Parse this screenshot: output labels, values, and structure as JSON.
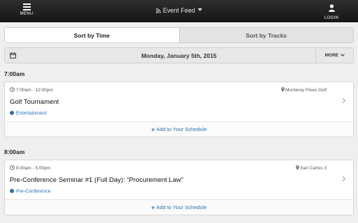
{
  "header": {
    "menu_label": "MENU",
    "feed_title": "Event Feed",
    "login_label": "LOGIN"
  },
  "sort_tabs": [
    {
      "label": "Sort by Time",
      "active": true
    },
    {
      "label": "Sort by Tracks",
      "active": false
    }
  ],
  "date_bar": {
    "date": "Monday, January 5th, 2015",
    "more_label": "MORE"
  },
  "groups": [
    {
      "time": "7:00am",
      "event": {
        "time_range": "7:00am - 12:00pm",
        "location": "Monterey Pines Golf",
        "title": "Golf Tournament",
        "track": "Entertainment",
        "track_color": "#2a6fb5",
        "add_label": "Add to Your Schedule"
      }
    },
    {
      "time": "8:00am",
      "event": {
        "time_range": "8:00am - 5:00pm",
        "location": "San Carlos 3",
        "title": "Pre-Conference Seminar #1 (Full Day): “Procurement Law”",
        "track": "Pre-Conference",
        "track_color": "#2a6fb5",
        "add_label": "Add to Your Schedule"
      }
    }
  ],
  "icons": {
    "menu": "hamburger-icon",
    "feed": "rss-icon",
    "login": "user-icon",
    "calendar": "calendar-icon",
    "time": "clock-icon",
    "location": "map-pin-icon",
    "more": "chevron-down-icon",
    "open_event": "chevron-right-icon"
  },
  "colors": {
    "topbar": "#1f1f1f",
    "accent": "#2a6fb5",
    "background": "#efefef"
  }
}
